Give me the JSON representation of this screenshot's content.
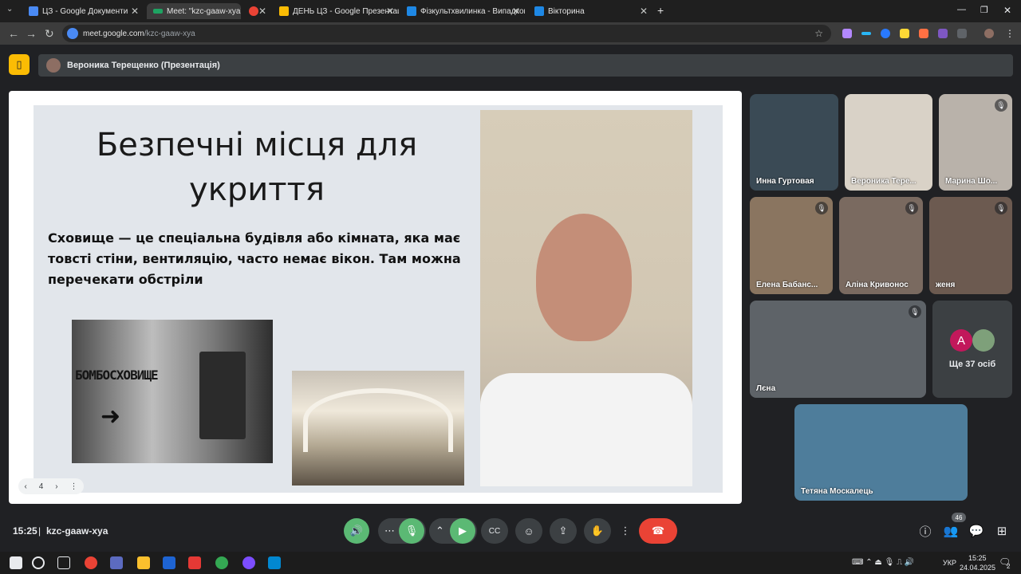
{
  "browser": {
    "tabs": [
      {
        "label": "ЦЗ - Google Документи",
        "fav_color": "#4a8af4"
      },
      {
        "label": "Meet: \"kzc-gaaw-xya\"",
        "fav_color": "#1ea362"
      },
      {
        "label": "",
        "fav_color": "#ea4335"
      },
      {
        "label": "ДЕНЬ ЦЗ - Google Презентації",
        "fav_color": "#fbbc04"
      },
      {
        "label": "Фізкультхвилинка - Випадкові",
        "fav_color": "#1e88e5"
      },
      {
        "label": "Вікторина",
        "fav_color": "#1e88e5"
      }
    ],
    "new_tab": "+",
    "url_host": "meet.google.com",
    "url_path": "/kzc-gaaw-xya"
  },
  "meet": {
    "presenter_label": "Вероника Терещенко (Презентація)",
    "slide": {
      "title": "Безпечні місця для укриття",
      "body": "Сховище — це спеціальна будівля або кімната, яка має товсті стіни, вентиляцію, часто немає вікон. Там можна перечекати обстріли",
      "sign_text": "БОМБОСХОВИЩЕ",
      "page_number": "4"
    },
    "participants": [
      {
        "name": "Инна Гуртовая",
        "muted": false,
        "bg": "#3a4a55"
      },
      {
        "name": "Вероника Тере...",
        "muted": false,
        "bg": "#d9d2c7"
      },
      {
        "name": "Марина Шо...",
        "muted": true,
        "bg": "#b9b2aa"
      },
      {
        "name": "Елена Бабанс...",
        "muted": true,
        "bg": "#8a7560"
      },
      {
        "name": "Аліна Кривонос",
        "muted": true,
        "bg": "#7a6a60"
      },
      {
        "name": "женя",
        "muted": true,
        "bg": "#6c5a50"
      },
      {
        "name": "Лєна",
        "muted": true,
        "bg": "#5e6368"
      },
      {
        "name": "Тетяна Москалець",
        "muted": false,
        "bg": "#4e7d9b"
      }
    ],
    "more": {
      "avatar_letter": "A",
      "label": "Ще 37 осіб"
    },
    "time": "15:25",
    "code": "kzc-gaaw-xya",
    "people_count": "46"
  },
  "taskbar": {
    "lang": "УКР",
    "time": "15:25",
    "date": "24.04.2025",
    "notif": "2"
  },
  "colors": {
    "accent_green": "#5bb974",
    "end_red": "#ea4335",
    "meet_bg": "#202124"
  }
}
